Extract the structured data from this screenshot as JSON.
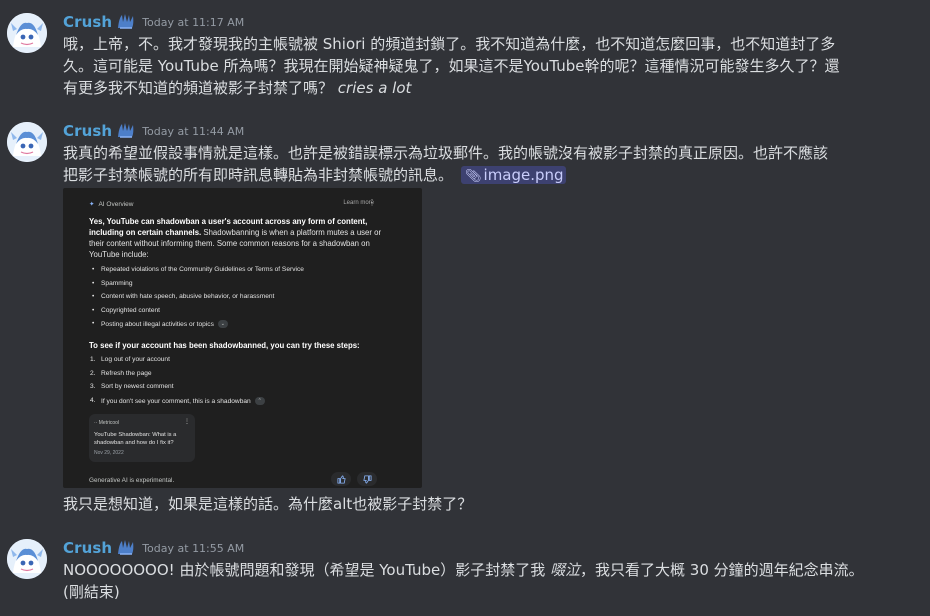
{
  "messages": [
    {
      "username": "Crush",
      "timestamp": "Today at 11:17 AM",
      "lines": [
        "哦，上帝，不。我才發現我的主帳號被 Shiori 的頻道封鎖了。我不知道為什麼，也不知道怎麼回事，也不知道封了多",
        "久。這可能是 YouTube 所為嗎？我現在開始疑神疑鬼了，如果這不是YouTube幹的呢？這種情況可能發生多久了？還",
        "有更多我不知道的頻道被影子封禁了嗎？"
      ],
      "italic_tail": "cries a lot"
    },
    {
      "username": "Crush",
      "timestamp": "Today at 11:44 AM",
      "lines": [
        "我真的希望並假設事情就是這樣。也許是被錯誤標示為垃圾郵件。我的帳號沒有被影子封禁的真正原因。也許不應該",
        "把影子封禁帳號的所有即時訊息轉貼為非封禁帳號的訊息。"
      ],
      "attachment": "image.png",
      "after_image": "我只是想知道，如果是這樣的話。為什麼alt也被影子封禁了？"
    },
    {
      "username": "Crush",
      "timestamp": "Today at 11:55 AM",
      "line1_a": "NOOOOOOOO! 由於帳號問題和發現（希望是 YouTube）影子封禁了我 ",
      "line1_italic": "啜泣",
      "line1_b": "，我只看了大概 30 分鐘的週年紀念串流。",
      "line2": "(剛結束)"
    }
  ],
  "image": {
    "header": "AI Overview",
    "learn_more": "Learn more",
    "intro_bold": "Yes, YouTube can shadowban a user's account across any form of content, including on certain channels.",
    "intro_rest": " Shadowbanning is when a platform mutes a user or their content without informing them. Some common reasons for a shadowban on YouTube include:",
    "bullets": [
      "Repeated violations of the Community Guidelines or Terms of Service",
      "Spamming",
      "Content with hate speech, abusive behavior, or harassment",
      "Copyrighted content",
      "Posting about illegal activities or topics"
    ],
    "steps_title": "To see if your account has been shadowbanned, you can try these steps:",
    "steps": [
      "Log out of your account",
      "Refresh the page",
      "Sort by newest comment",
      "If you don't see your comment, this is a shadowban"
    ],
    "card_source": "Metricool",
    "card_title": "YouTube Shadowban: What is a shadowban and how do I fix it?",
    "card_date": "Nov 29, 2022",
    "footer": "Generative AI is experimental."
  },
  "colors": {
    "background": "#313338",
    "username": "#53a3d8",
    "timestamp": "#949ba4",
    "text": "#dbdee1"
  },
  "icons": [
    "avatar",
    "role-icon",
    "paperclip-icon",
    "thumbs-up-icon",
    "thumbs-down-icon"
  ]
}
